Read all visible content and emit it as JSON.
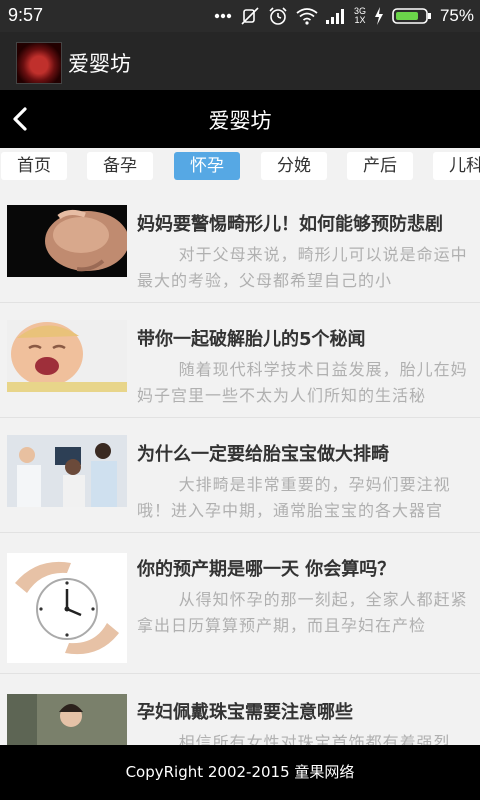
{
  "status_bar": {
    "time": "9:57",
    "network": "3G",
    "network_sub": "1X",
    "battery": "75%"
  },
  "app_bar": {
    "name": "爱婴坊"
  },
  "header": {
    "title": "爱婴坊"
  },
  "tabs": [
    {
      "label": "首页"
    },
    {
      "label": "备孕"
    },
    {
      "label": "怀孕"
    },
    {
      "label": "分娩"
    },
    {
      "label": "产后"
    },
    {
      "label": "儿科"
    }
  ],
  "active_tab": "怀孕",
  "articles": [
    {
      "title": "妈妈要警惕畸形儿！如何能够预防悲剧",
      "summary": "对于父母来说，畸形儿可以说是命运中最大的考验，父母都希望自己的小",
      "thumb": "pregnant-belly-image"
    },
    {
      "title": "带你一起破解胎儿的5个秘闻",
      "summary": "随着现代科学技术日益发展，胎儿在妈妈子宫里一些不太为人们所知的生活秘",
      "thumb": "crying-baby-image"
    },
    {
      "title": "为什么一定要给胎宝宝做大排畸",
      "summary": "大排畸是非常重要的，孕妈们要注视哦！进入孕中期，通常胎宝宝的各大器官",
      "thumb": "doctor-consultation-image"
    },
    {
      "title": "你的预产期是哪一天 你会算吗？",
      "summary": "从得知怀孕的那一刻起，全家人都赶紧拿出日历算算预产期，而且孕妇在产检",
      "thumb": "hands-clock-image"
    },
    {
      "title": "孕妇佩戴珠宝需要注意哪些",
      "summary": "相信所有女性对珠宝首饰都有着强烈",
      "thumb": "woman-jewelry-image"
    }
  ],
  "footer": {
    "text": "CopyRight 2002-2015 童果网络"
  },
  "colors": {
    "accent": "#56a8e4",
    "header_bg": "#000000",
    "app_bar_bg": "#262626"
  }
}
